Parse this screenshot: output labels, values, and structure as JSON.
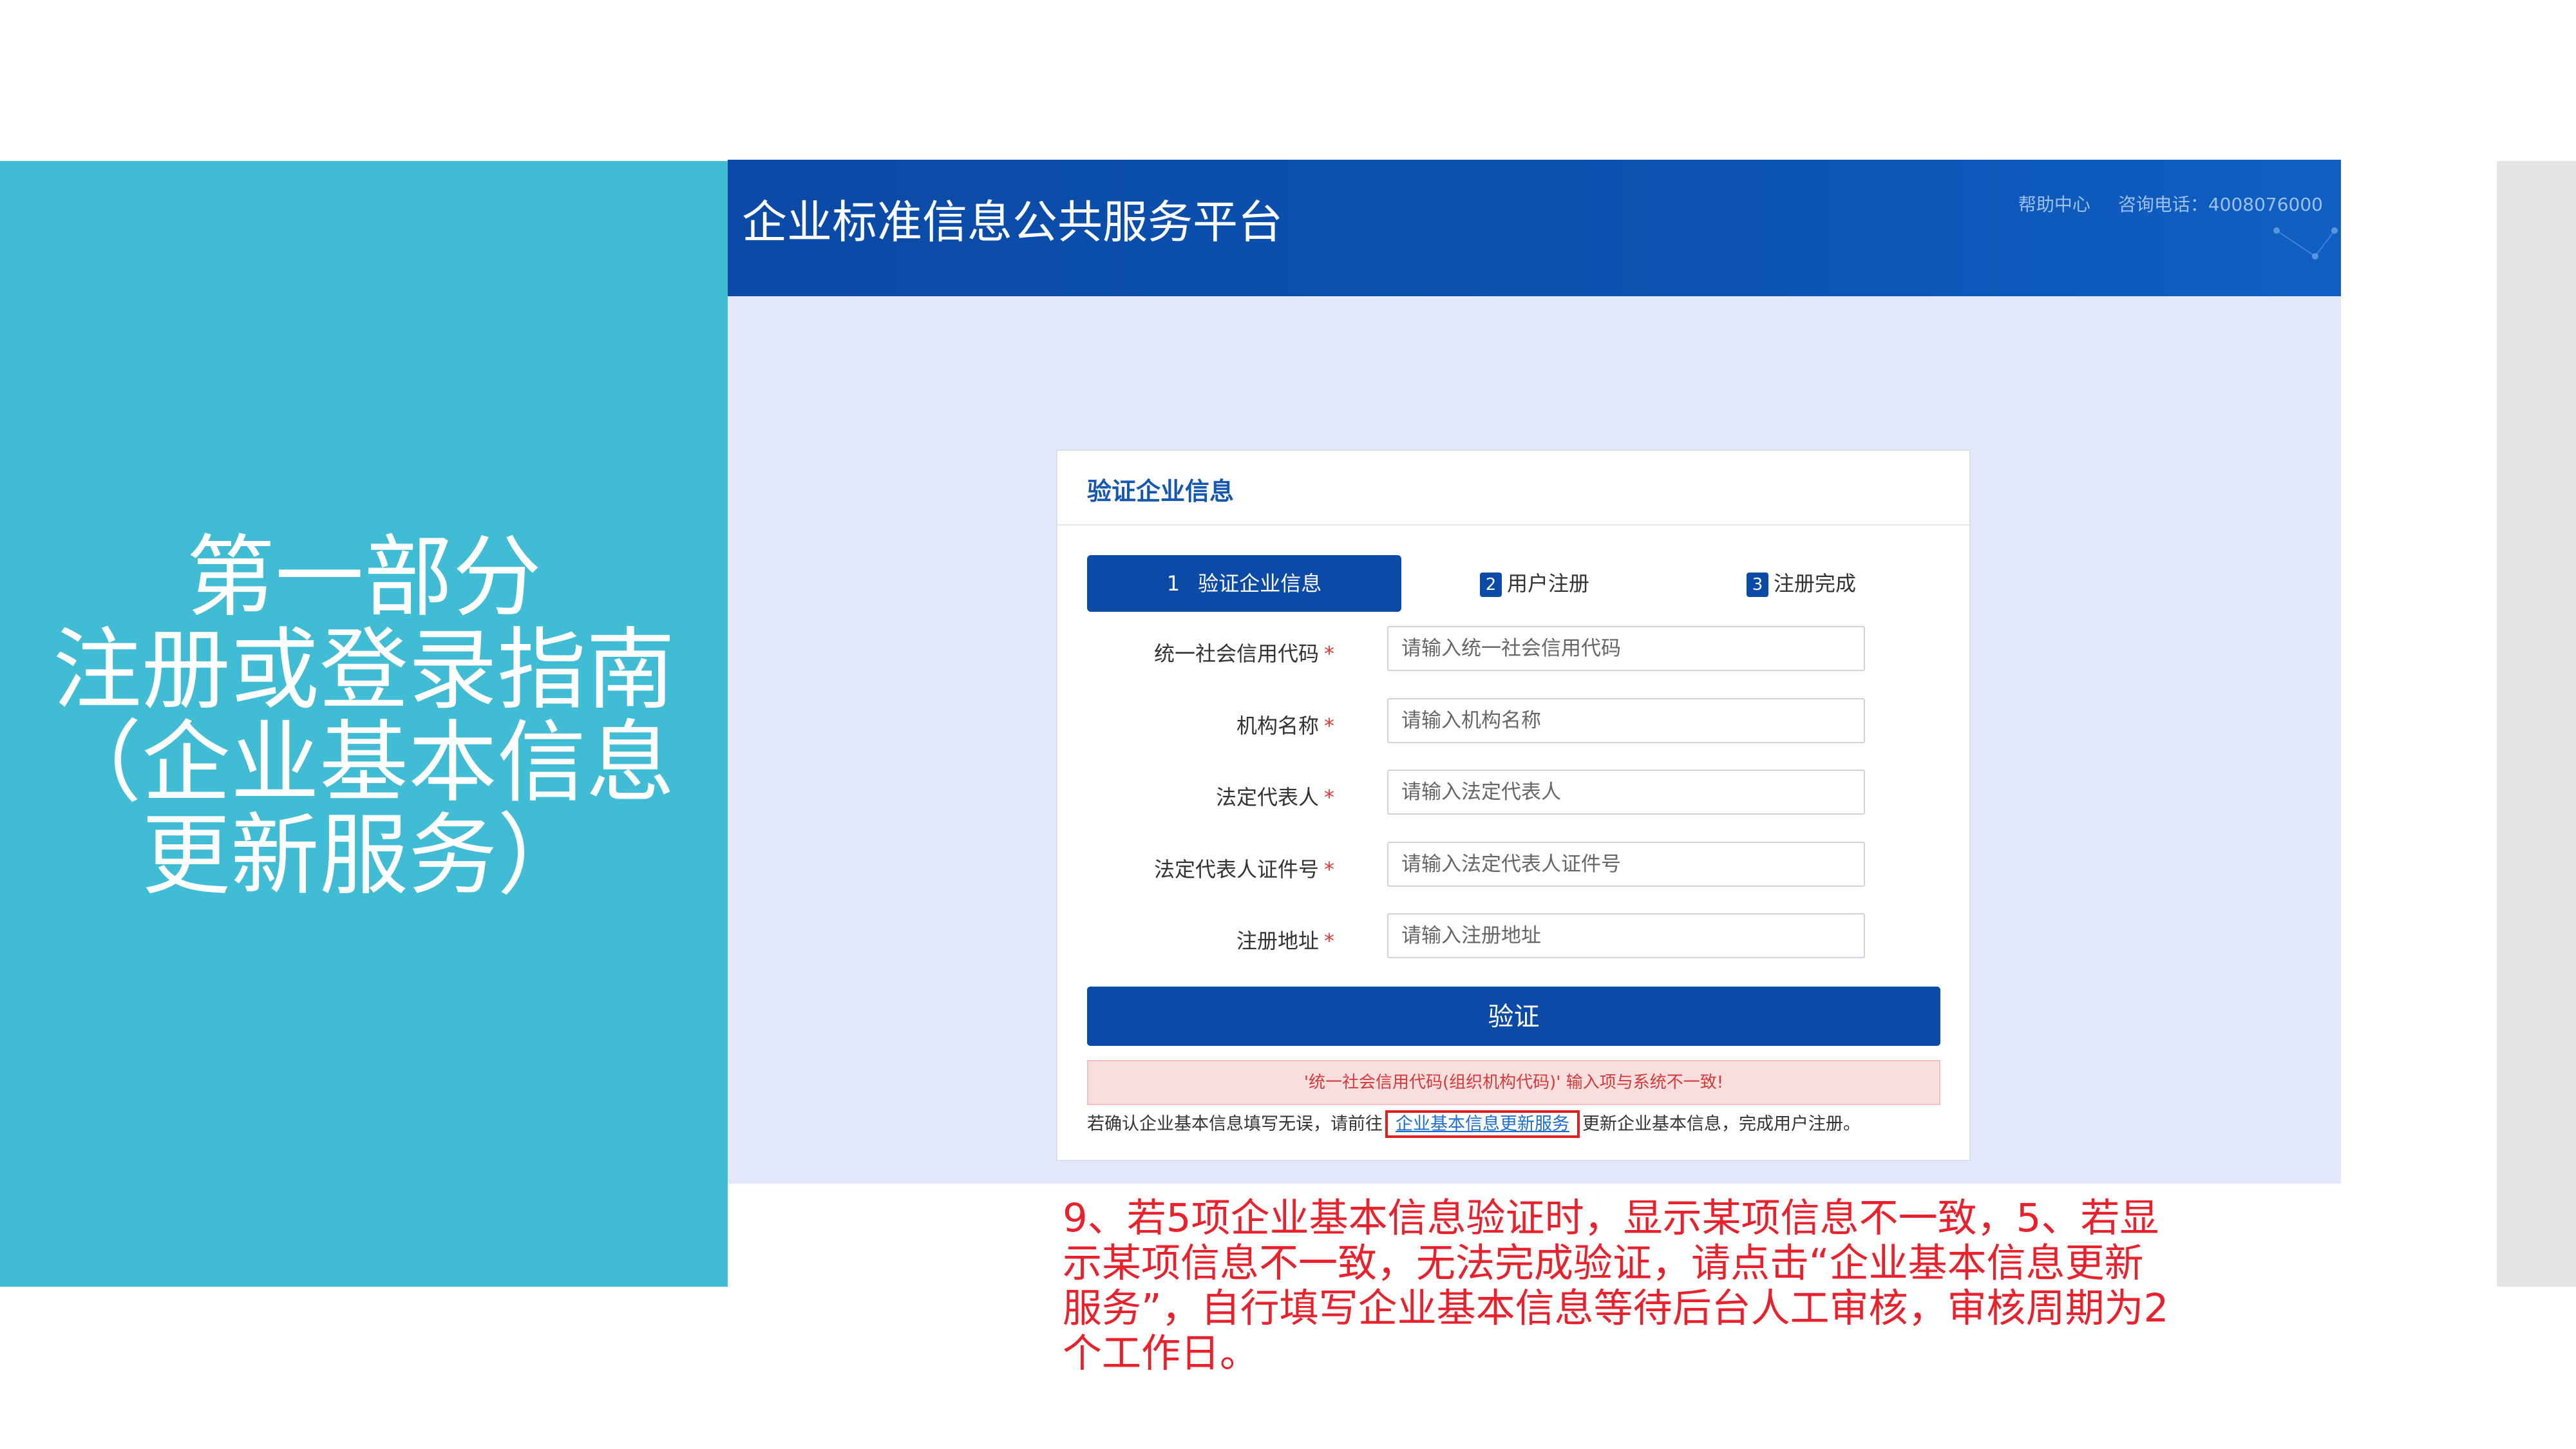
{
  "slide": {
    "section_title_lines": [
      "第一部分",
      "注册或登录指南",
      "（企业基本信息",
      "更新服务）"
    ],
    "note": "9、若5项企业基本信息验证时，显示某项信息不一致，5、若显示某项信息不一致，无法完成验证，请点击“企业基本信息更新服务”，自行填写企业基本信息等待后台人工审核，审核周期为2个工作日。"
  },
  "header": {
    "platform_title": "企业标准信息公共服务平台",
    "help_center": "帮助中心",
    "hotline": "咨询电话：4008076000"
  },
  "card": {
    "title": "验证企业信息",
    "steps": [
      {
        "num": "1",
        "label": "验证企业信息"
      },
      {
        "num": "2",
        "label": "用户注册"
      },
      {
        "num": "3",
        "label": "注册完成"
      }
    ],
    "fields": [
      {
        "label": "统一社会信用代码",
        "required": "*",
        "placeholder": "请输入统一社会信用代码",
        "value": ""
      },
      {
        "label": "机构名称",
        "required": "*",
        "placeholder": "请输入机构名称",
        "value": ""
      },
      {
        "label": "法定代表人",
        "required": "*",
        "placeholder": "请输入法定代表人",
        "value": ""
      },
      {
        "label": "法定代表人证件号",
        "required": "*",
        "placeholder": "请输入法定代表人证件号",
        "value": ""
      },
      {
        "label": "注册地址",
        "required": "*",
        "placeholder": "请输入注册地址",
        "value": ""
      }
    ],
    "verify_label": "验证",
    "error_message": "'统一社会信用代码(组织机构代码)' 输入项与系统不一致!",
    "hint_before": "若确认企业基本信息填写无误，请前往",
    "hint_link": "企业基本信息更新服务",
    "hint_after": "更新企业基本信息，完成用户注册。"
  },
  "colors": {
    "left_panel": "#40bcd4",
    "header_blue": "#0b4aa6",
    "note_red": "#e8212c",
    "page_bg": "#e4e8fb"
  }
}
